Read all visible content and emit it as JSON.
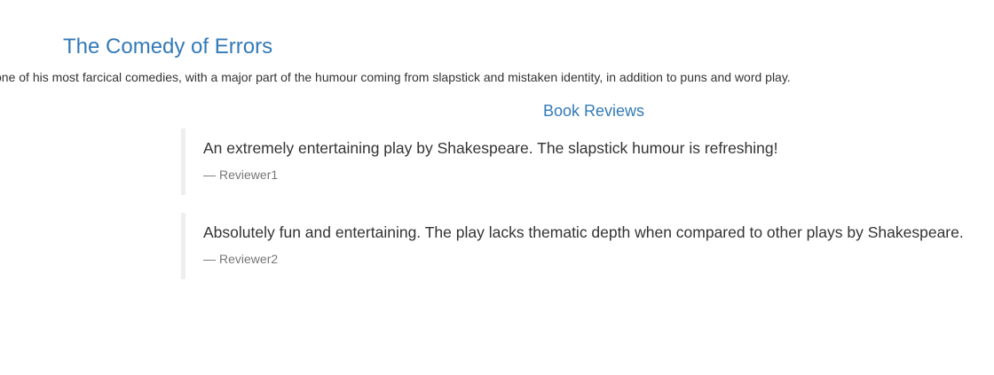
{
  "book": {
    "title": "The Comedy of Errors",
    "summary": "one of his most farcical comedies, with a major part of the humour coming from slapstick and mistaken identity, in addition to puns and word play."
  },
  "reviews": {
    "heading": "Book Reviews",
    "dash": "—",
    "items": [
      {
        "text": "An extremely entertaining play by Shakespeare. The slapstick humour is refreshing!",
        "author": "Reviewer1"
      },
      {
        "text": "Absolutely fun and entertaining. The play lacks thematic depth when compared to other plays by Shakespeare.",
        "author": "Reviewer2"
      }
    ]
  },
  "colors": {
    "link_blue": "#337ab7",
    "body_text": "#333333",
    "muted_text": "#777777",
    "quote_border": "#eeeeee"
  }
}
